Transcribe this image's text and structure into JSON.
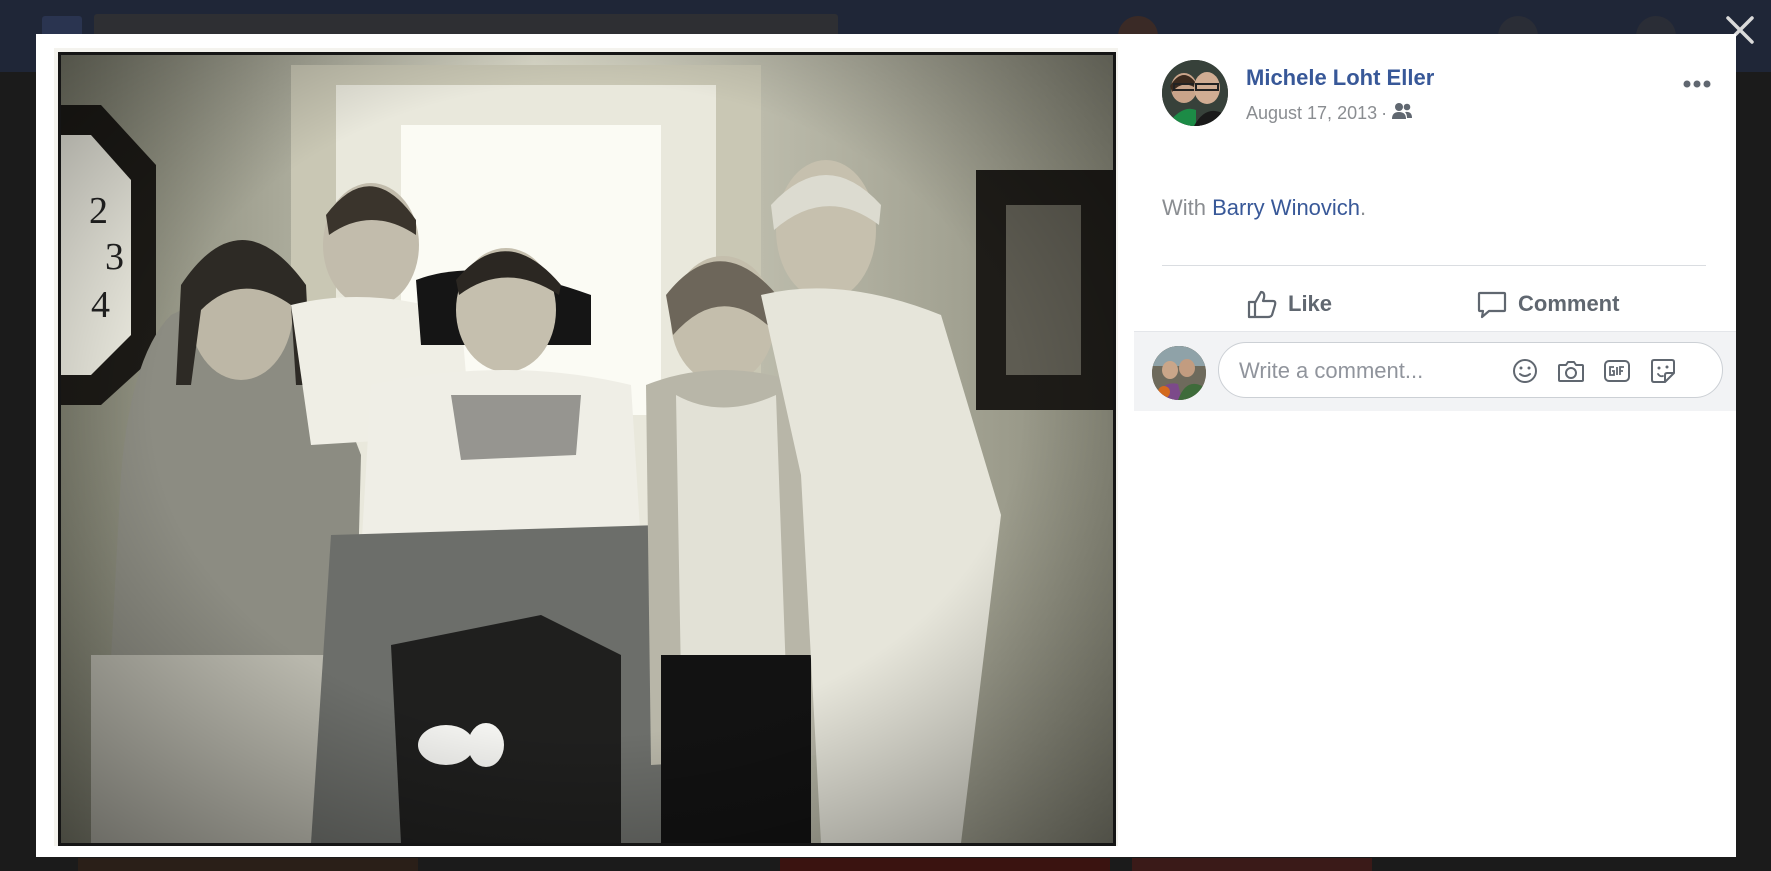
{
  "post": {
    "author": "Michele Loht Eller",
    "date": "August 17, 2013",
    "separator": "·",
    "audience_icon": "friends-icon",
    "with_prefix": "With",
    "tagged": "Barry Winovich",
    "with_suffix": "."
  },
  "actions": {
    "like_label": "Like",
    "comment_label": "Comment"
  },
  "comment_box": {
    "placeholder": "Write a comment...",
    "icons": [
      "emoji-icon",
      "camera-icon",
      "gif-icon",
      "sticker-icon"
    ]
  },
  "viewer": {
    "close_icon": "close-icon",
    "more_icon": "more-options-icon"
  },
  "colors": {
    "link": "#385898",
    "meta": "#8a8d91",
    "action": "#606770"
  }
}
